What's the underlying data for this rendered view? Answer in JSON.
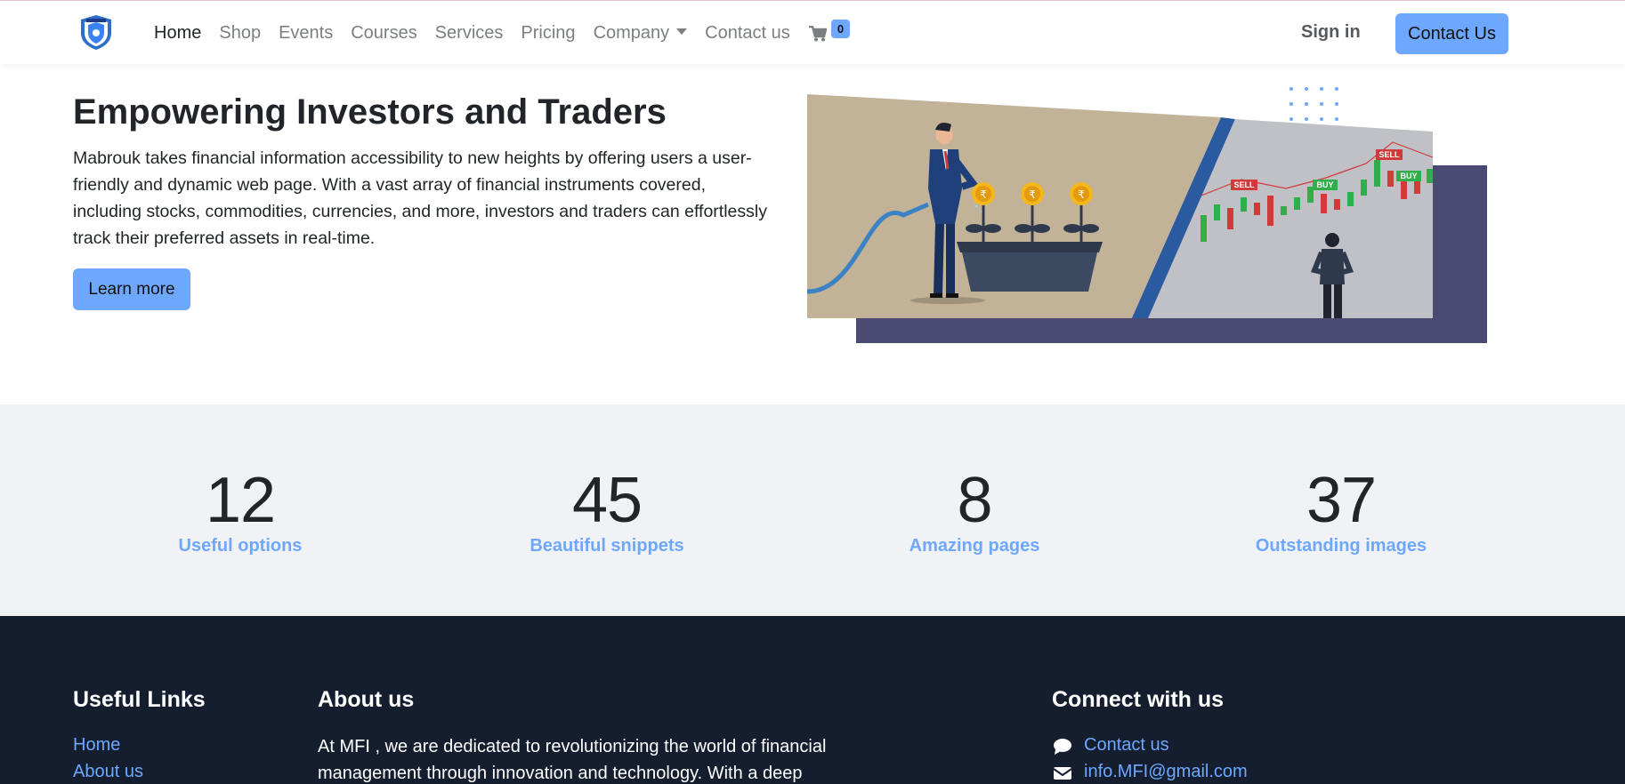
{
  "nav": {
    "links": [
      "Home",
      "Shop",
      "Events",
      "Courses",
      "Services",
      "Pricing",
      "Company",
      "Contact us"
    ],
    "cart_count": "0",
    "signin_label": "Sign in",
    "contact_label": "Contact Us",
    "logo_icon": "shield-logo-icon",
    "cart_icon": "cart-icon"
  },
  "hero": {
    "title": "Empowering Investors and Traders",
    "text": "Mabrouk takes financial information accessibility to new heights by offering users a user-friendly and dynamic web page. With a vast array of financial instruments covered, including stocks, commodities, currencies, and more, investors and traders can effortlessly track their preferred assets in real-time.",
    "button_label": "Learn more",
    "illustration": {
      "coin_symbol": "₹",
      "tags": [
        "SELL",
        "BUY",
        "SELL",
        "BUY"
      ]
    }
  },
  "stats": [
    {
      "value": "12",
      "label": "Useful options"
    },
    {
      "value": "45",
      "label": "Beautiful snippets"
    },
    {
      "value": "8",
      "label": "Amazing pages"
    },
    {
      "value": "37",
      "label": "Outstanding images"
    }
  ],
  "footer": {
    "useful_links": {
      "title": "Useful Links",
      "items": [
        "Home",
        "About us"
      ]
    },
    "about": {
      "title": "About us",
      "text": "At MFI , we are dedicated to revolutionizing the world of financial management through innovation and technology. With a deep"
    },
    "connect": {
      "title": "Connect with us",
      "contact_label": "Contact us",
      "email": "info.MFI@gmail.com",
      "contact_icon": "chat-bubble-icon",
      "email_icon": "envelope-icon"
    }
  },
  "colors": {
    "accent": "#6ea8fe",
    "footer_bg": "#151e2f",
    "stats_bg": "#f0f2f5",
    "art_bg": "#c1b298",
    "art_panel": "#4a4a72"
  }
}
